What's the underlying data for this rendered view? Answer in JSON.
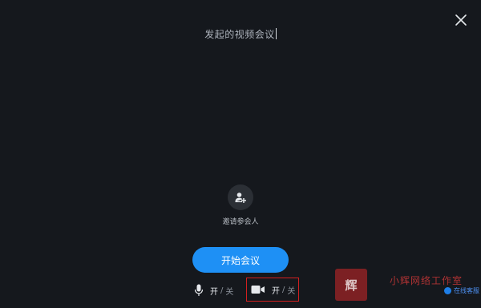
{
  "meeting": {
    "title_text": "发起的视频会议"
  },
  "invite": {
    "label": "邀请参会人"
  },
  "actions": {
    "start_label": "开始会议"
  },
  "controls": {
    "mic": {
      "on_label": "开",
      "separator": "/",
      "off_label": "关"
    },
    "camera": {
      "on_label": "开",
      "separator": "/",
      "off_label": "关"
    }
  },
  "watermark": {
    "logo_text": "辉",
    "studio_text": "小辉网络工作室",
    "badge_text": "在线客服"
  },
  "colors": {
    "background": "#15181d",
    "primary": "#1e90f5",
    "highlight_box": "#d21f1f"
  }
}
